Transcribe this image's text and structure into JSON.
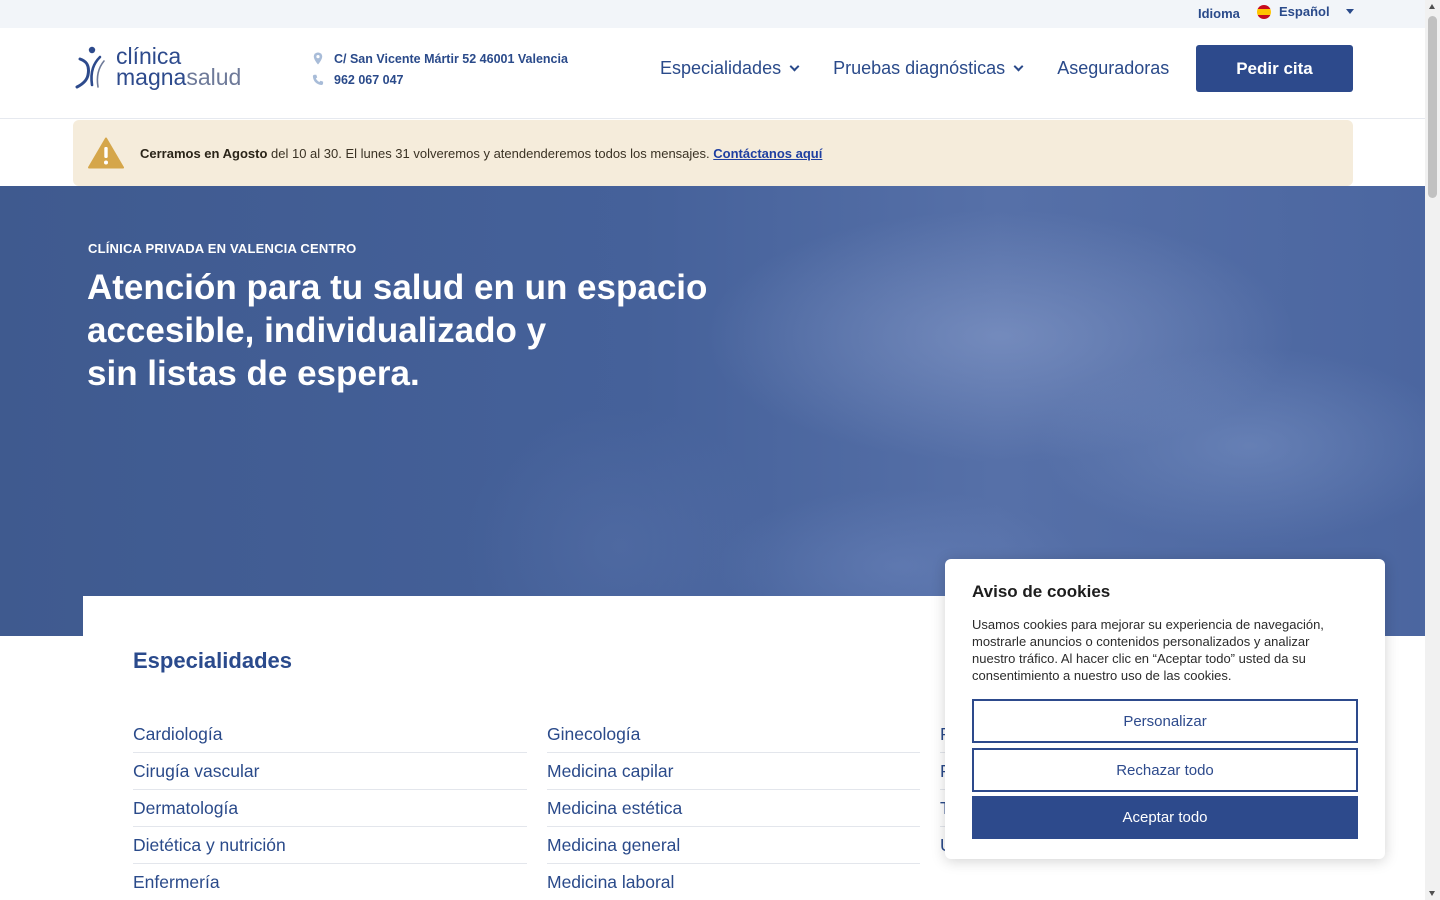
{
  "topbar": {
    "language_label": "Idioma",
    "language_value": "Español"
  },
  "header": {
    "logo_line1": "clínica",
    "logo_line2a": "magna",
    "logo_line2b": "salud",
    "address": "C/ San Vicente Mártir 52 46001 Valencia",
    "phone": "962 067 047",
    "nav": {
      "especialidades": "Especialidades",
      "pruebas": "Pruebas diagnósticas",
      "aseguradoras": "Aseguradoras"
    },
    "cta": "Pedir cita"
  },
  "notice": {
    "bold": "Cerramos en Agosto",
    "text": " del 10 al 30. El lunes 31 volveremos y atendenderemos todos los mensajes. ",
    "link": "Contáctanos aquí"
  },
  "hero": {
    "kicker": "CLÍNICA PRIVADA EN VALENCIA CENTRO",
    "title_line1": "Atención para tu salud en un espacio",
    "title_line2": "accesible, individualizado y",
    "title_line3": "sin listas de espera."
  },
  "specialties": {
    "title": "Especialidades",
    "col1": [
      "Cardiología",
      "Cirugía vascular",
      "Dermatología",
      "Dietética y nutrición",
      "Enfermería"
    ],
    "col2": [
      "Ginecología",
      "Medicina capilar",
      "Medicina estética",
      "Medicina general",
      "Medicina laboral"
    ],
    "col3": [
      "P",
      "P",
      "T",
      "U"
    ]
  },
  "cookies": {
    "title": "Aviso de cookies",
    "body": "Usamos cookies para mejorar su experiencia de navegación, mostrarle anuncios o contenidos personalizados y analizar nuestro tráfico. Al hacer clic en “Aceptar todo” usted da su consentimiento a nuestro uso de las cookies.",
    "customize": "Personalizar",
    "reject": "Rechazar todo",
    "accept": "Aceptar todo"
  },
  "colors": {
    "brand": "#2d4a8c",
    "notice_bg": "#f5ecdb",
    "warning": "#d5a64a"
  }
}
